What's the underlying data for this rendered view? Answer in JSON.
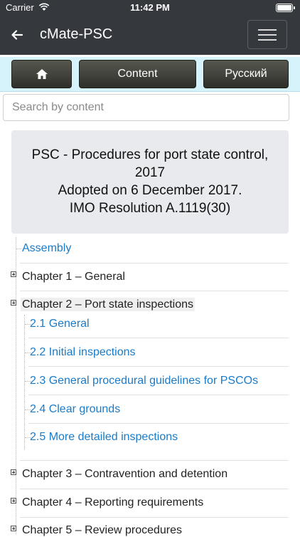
{
  "status_bar": {
    "carrier": "Carrier",
    "time": "11:42 PM"
  },
  "app_bar": {
    "title": "cMate-PSC"
  },
  "toolbar": {
    "content_label": "Content",
    "language_label": "Русский"
  },
  "search": {
    "placeholder": "Search by content",
    "value": ""
  },
  "document": {
    "title_lines": [
      "PSC - Procedures for port state control,",
      "2017",
      "Adopted on 6 December 2017.",
      "IMO Resolution A.1119(30)"
    ]
  },
  "tree": {
    "assembly": "Assembly",
    "chapter1": "Chapter 1 – General",
    "chapter2": "Chapter 2 – Port state inspections",
    "chapter2_sections": [
      "2.1 General",
      "2.2 Initial inspections",
      "2.3 General procedural guidelines for PSCOs",
      "2.4 Clear grounds",
      "2.5 More detailed inspections"
    ],
    "chapter3": "Chapter 3 – Contravention and detention",
    "chapter4": "Chapter 4 – Reporting requirements",
    "chapter5": "Chapter 5 – Review procedures"
  },
  "colors": {
    "bar": "#35393d",
    "toolbar_bg": "#d6f3fb",
    "link": "#1a7bc9"
  }
}
